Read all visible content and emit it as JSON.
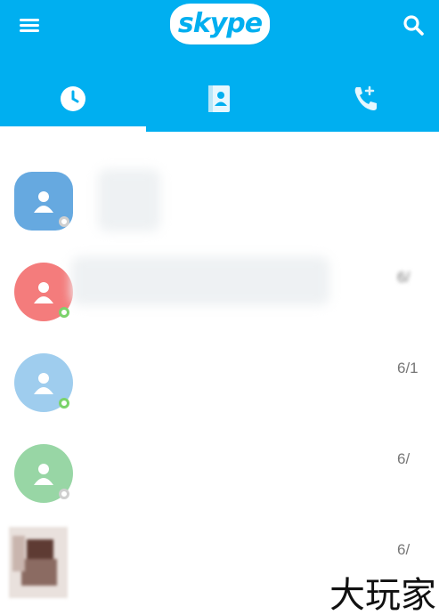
{
  "app": {
    "logo_text": "skype",
    "brand_color": "#00aff0"
  },
  "header": {
    "menu_icon": "hamburger-menu-icon",
    "search_icon": "search-icon"
  },
  "tabs": [
    {
      "name": "recent",
      "icon": "clock-icon",
      "active": true
    },
    {
      "name": "contacts",
      "icon": "contacts-book-icon",
      "active": false
    },
    {
      "name": "calls",
      "icon": "phone-icon",
      "active": false
    }
  ],
  "conversations": [
    {
      "name": "",
      "preview": "",
      "date": "",
      "avatar_color": "#66a9e0",
      "status": "grey"
    },
    {
      "name": "",
      "preview": "",
      "date": "6/",
      "avatar_color": "#f47c7c",
      "status": "online"
    },
    {
      "name": "",
      "preview": "",
      "date": "6/1",
      "avatar_color": "#9fcdee",
      "status": "online"
    },
    {
      "name": "",
      "preview": "",
      "date": "6/",
      "avatar_color": "#98d6a5",
      "status": "grey"
    },
    {
      "name": "",
      "preview": "",
      "date": "6/",
      "avatar_color": "photo",
      "status": "none"
    }
  ],
  "watermark": "大玩家"
}
